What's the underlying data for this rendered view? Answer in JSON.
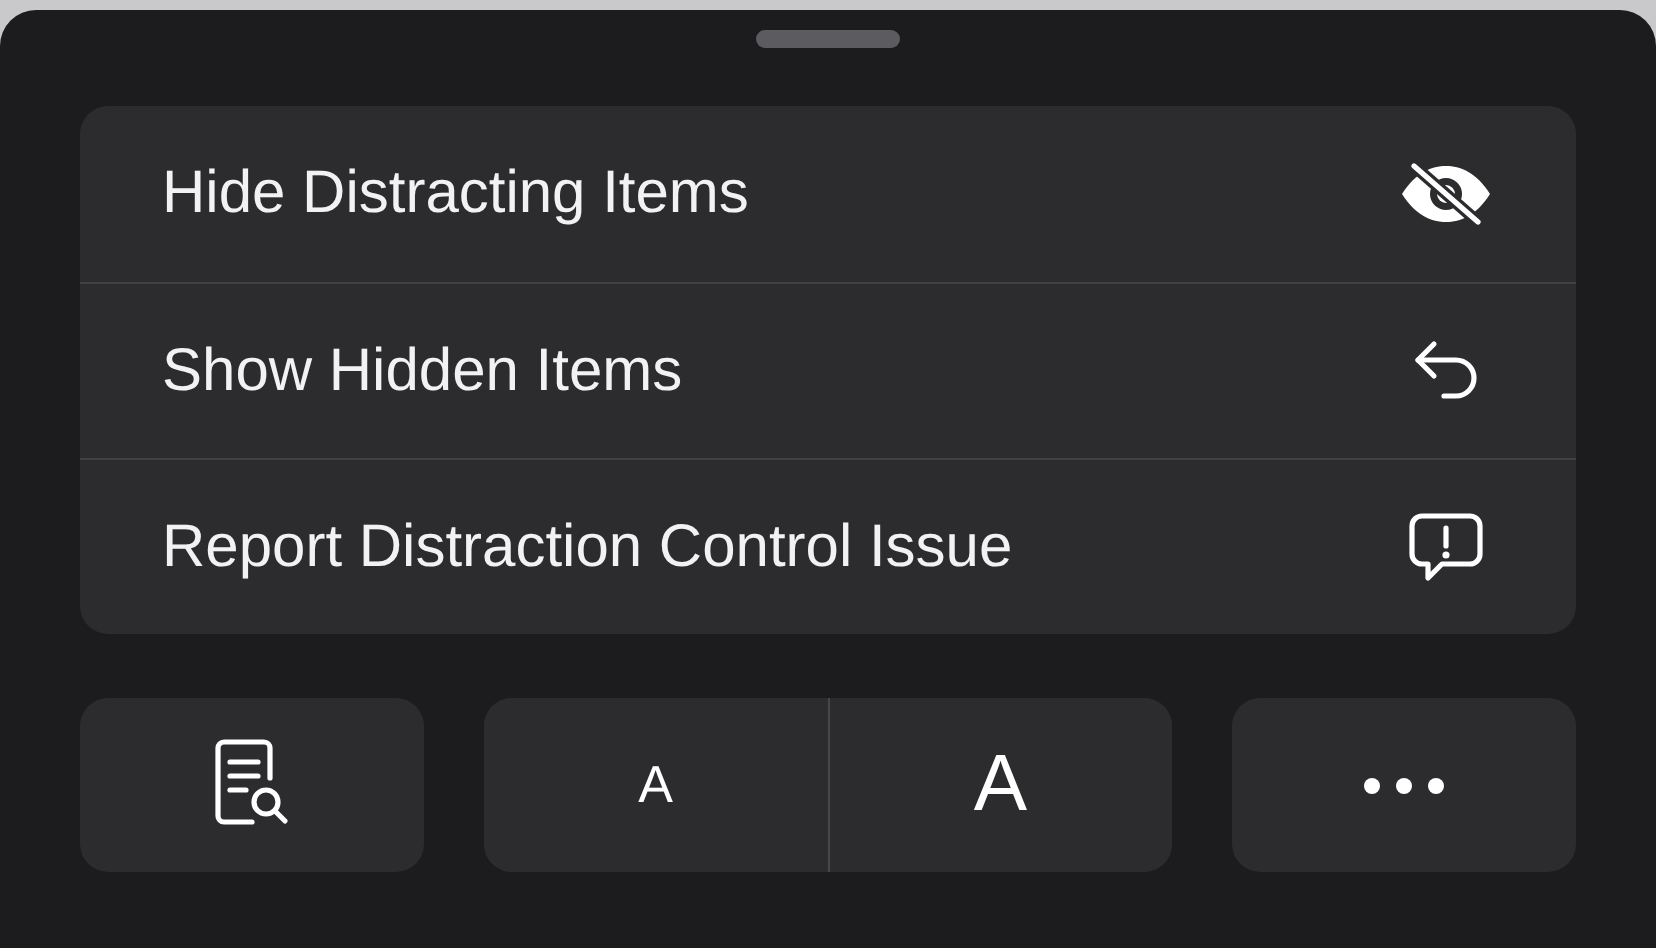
{
  "menu": [
    {
      "label": "Hide Distracting Items"
    },
    {
      "label": "Show Hidden Items"
    },
    {
      "label": "Report Distraction Control Issue"
    }
  ],
  "text_size": [
    {
      "label": "A",
      "kind": "smaller"
    },
    {
      "label": "A",
      "kind": "larger"
    }
  ]
}
